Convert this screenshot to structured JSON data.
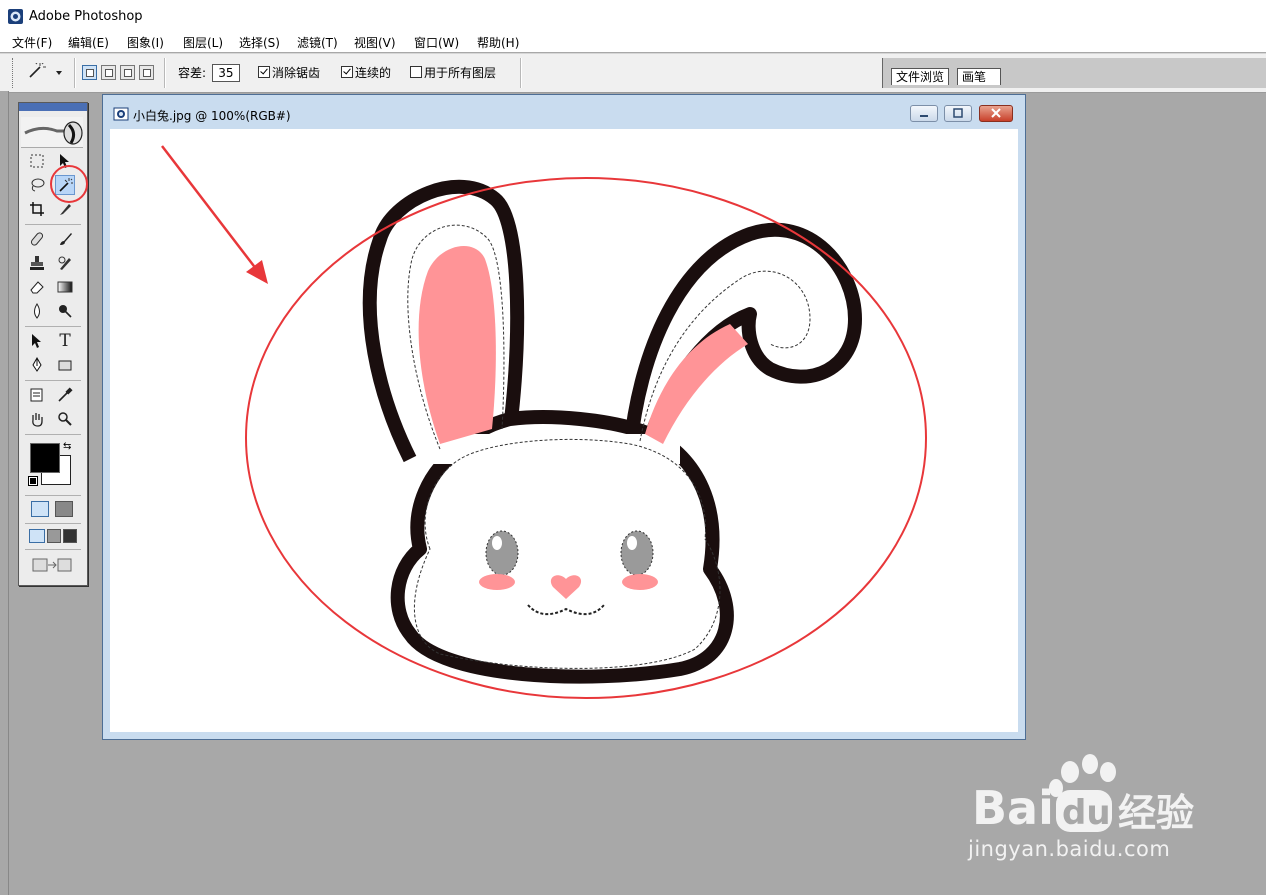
{
  "app": {
    "title": "Adobe Photoshop"
  },
  "menu": [
    "文件(F)",
    "编辑(E)",
    "图象(I)",
    "图层(L)",
    "选择(S)",
    "滤镜(T)",
    "视图(V)",
    "窗口(W)",
    "帮助(H)"
  ],
  "options": {
    "tolerance_label": "容差:",
    "tolerance_value": "35",
    "antialias_label": "消除锯齿",
    "antialias_checked": true,
    "contiguous_label": "连续的",
    "contiguous_checked": true,
    "all_layers_label": "用于所有图层",
    "all_layers_checked": false
  },
  "palette_well": {
    "tabs": [
      "文件浏览",
      "画笔"
    ]
  },
  "toolbox": {
    "tools": [
      "rectangular-marquee",
      "move",
      "lasso",
      "magic-wand",
      "crop",
      "slice",
      "healing-brush",
      "brush",
      "clone-stamp",
      "history-brush",
      "eraser",
      "gradient",
      "blur",
      "dodge",
      "path-selection",
      "type",
      "pen",
      "shape",
      "notes",
      "eyedropper",
      "hand",
      "zoom"
    ],
    "active_tool": "magic-wand",
    "foreground_color": "#000000",
    "background_color": "#ffffff"
  },
  "document": {
    "title": "小白兔.jpg @ 100%(RGB#)",
    "zoom": "100%",
    "mode": "RGB"
  },
  "colors": {
    "annotation_red": "#e8373a",
    "ear_pink": "#ff9497",
    "outline": "#1a0e0e"
  },
  "watermark": {
    "brand": "Bai du 经验",
    "url": "jingyan.baidu.com"
  }
}
